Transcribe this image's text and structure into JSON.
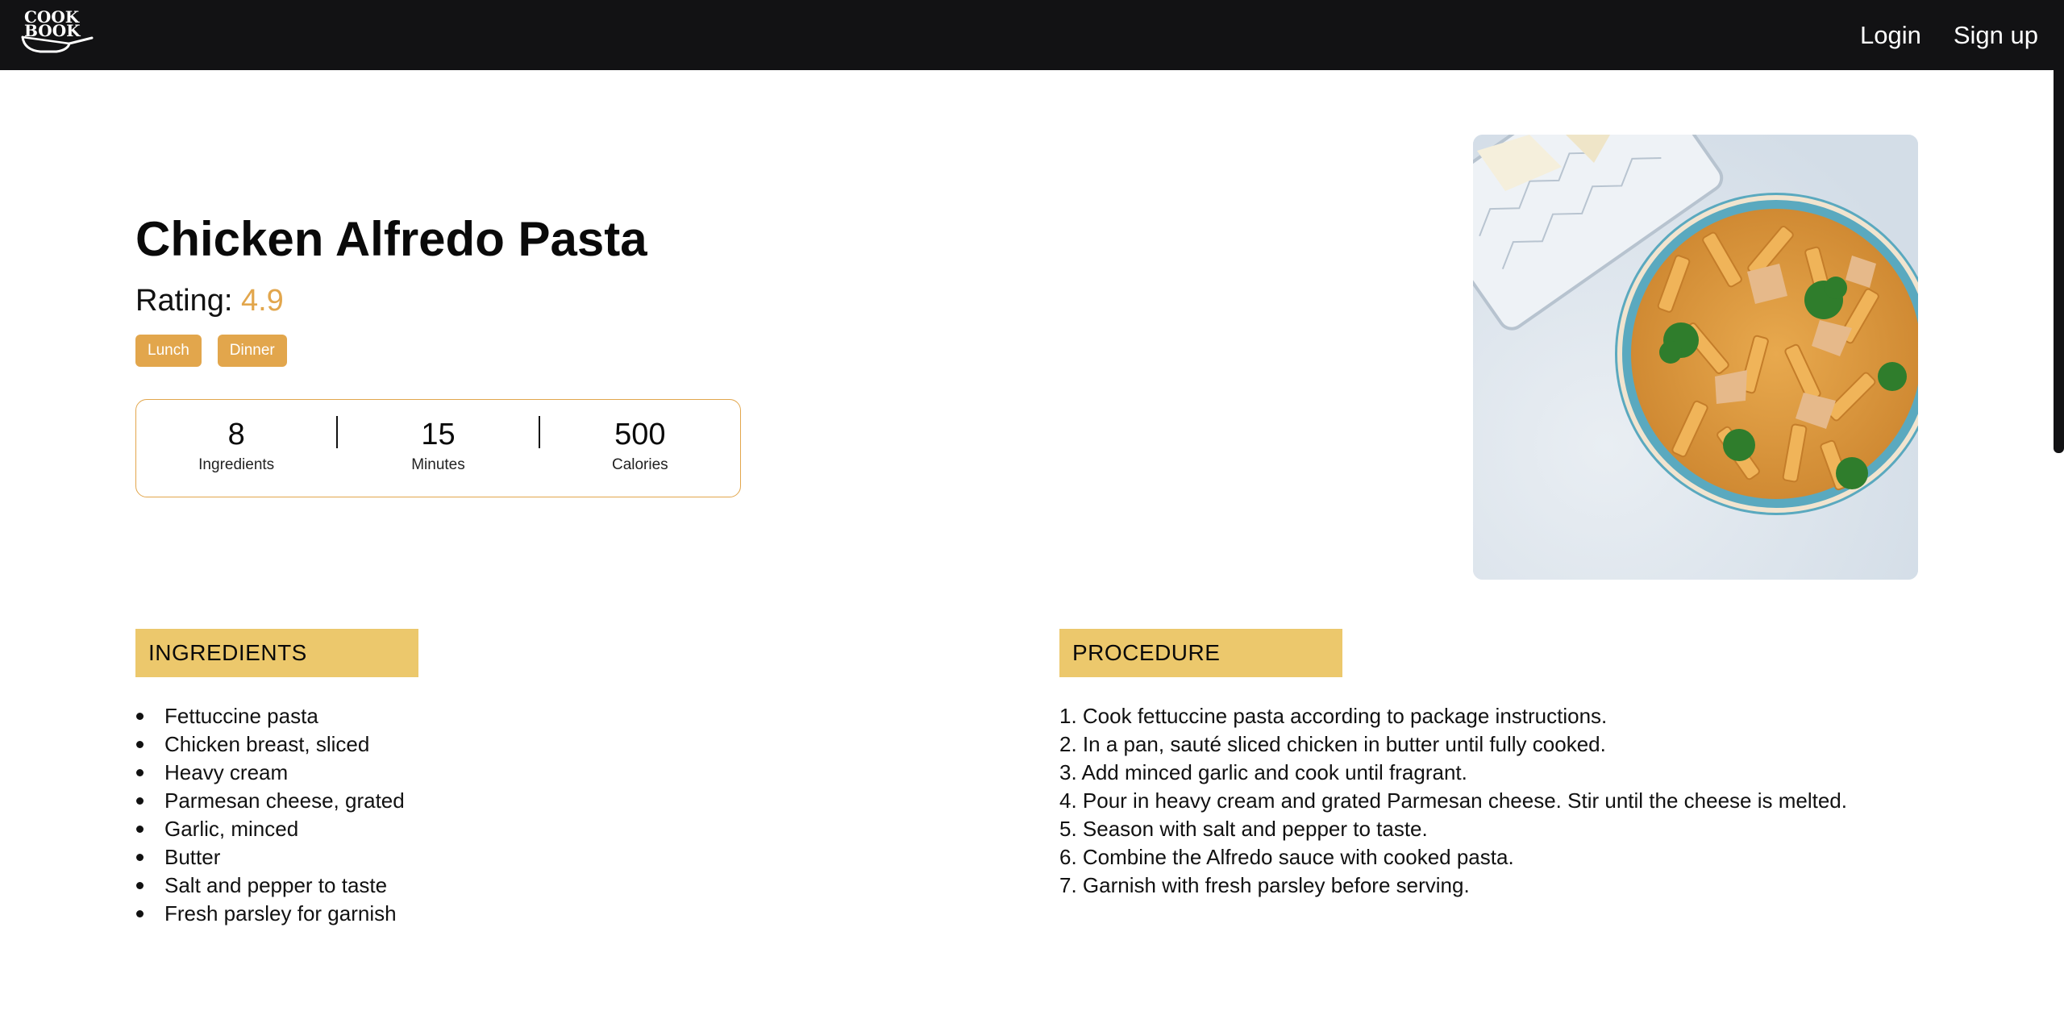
{
  "app": {
    "logo_text_top": "COOK",
    "logo_text_bottom": "BOOK"
  },
  "nav": {
    "login_label": "Login",
    "signup_label": "Sign up"
  },
  "recipe": {
    "title": "Chicken Alfredo Pasta",
    "rating_label": "Rating:",
    "rating_value": "4.9",
    "tags": [
      "Lunch",
      "Dinner"
    ],
    "stats": [
      {
        "value": "8",
        "label": "Ingredients"
      },
      {
        "value": "15",
        "label": "Minutes"
      },
      {
        "value": "500",
        "label": "Calories"
      }
    ]
  },
  "ingredients": {
    "heading": "INGREDIENTS",
    "items": [
      "Fettuccine pasta",
      "Chicken breast, sliced",
      "Heavy cream",
      "Parmesan cheese, grated",
      "Garlic, minced",
      "Butter",
      "Salt and pepper to taste",
      "Fresh parsley for garnish"
    ]
  },
  "procedure": {
    "heading": "PROCEDURE",
    "steps": [
      "1. Cook fettuccine pasta according to package instructions.",
      "2. In a pan, sauté sliced chicken in butter until fully cooked.",
      "3. Add minced garlic and cook until fragrant.",
      "4. Pour in heavy cream and grated Parmesan cheese. Stir until the cheese is melted.",
      "5. Season with salt and pepper to taste.",
      "6. Combine the Alfredo sauce with cooked pasta.",
      "7. Garnish with fresh parsley before serving."
    ]
  },
  "colors": {
    "navbar_bg": "#121214",
    "accent": "#e2a64c",
    "section_header_bg": "#ecc86c"
  },
  "icons": {
    "logo": "cookbook-pan-logo"
  }
}
